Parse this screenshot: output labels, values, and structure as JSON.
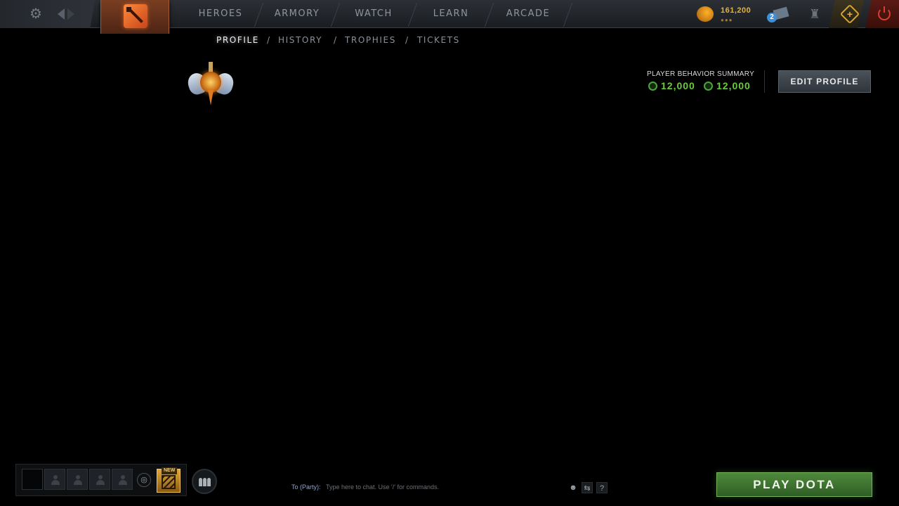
{
  "topbar": {
    "settings_icon": "gear-icon",
    "back_icon": "arrow-back-icon",
    "forward_icon": "arrow-forward-icon",
    "logo_icon": "dota-logo-icon",
    "nav": [
      {
        "label": "HEROES"
      },
      {
        "label": "ARMORY"
      },
      {
        "label": "WATCH"
      },
      {
        "label": "LEARN"
      },
      {
        "label": "ARCADE"
      }
    ],
    "gold": {
      "value": "161,200",
      "dots": "●●●",
      "icon": "gold-coin-icon"
    },
    "notifications": {
      "count": "2",
      "icon": "envelope-icon"
    },
    "armory_icon": "armory-icon",
    "plus_icon": "dota-plus-icon",
    "plus_symbol": "+",
    "power_icon": "power-icon"
  },
  "subnav": {
    "items": [
      "PROFILE",
      "HISTORY",
      "TROPHIES",
      "TICKETS"
    ],
    "separator": "/",
    "active": "PROFILE"
  },
  "profile": {
    "rank_medal_icon": "rank-medal-icon",
    "behavior": {
      "title": "PLAYER BEHAVIOR SUMMARY",
      "scores": [
        "12,000",
        "12,000"
      ]
    },
    "edit_button": "EDIT PROFILE"
  },
  "bottom": {
    "party_slots": 5,
    "voice_icon": "headset-icon",
    "voice_symbol": "◎",
    "new_badge": "NEW",
    "friends_icon": "friends-icon",
    "chat": {
      "label": "To (Party):",
      "placeholder": "Type here to chat. Use '/' for commands.",
      "emoji_symbol": "☻",
      "translate_symbol": "⇆",
      "help_symbol": "?"
    },
    "play_button": "PLAY DOTA"
  },
  "colors": {
    "accent_orange": "#c8451a",
    "gold": "#e9b233",
    "behavior_green": "#6ccb3c",
    "play_green": "#4e8a3c",
    "power_red": "#d6402f",
    "notif_blue": "#3f8fd6"
  }
}
